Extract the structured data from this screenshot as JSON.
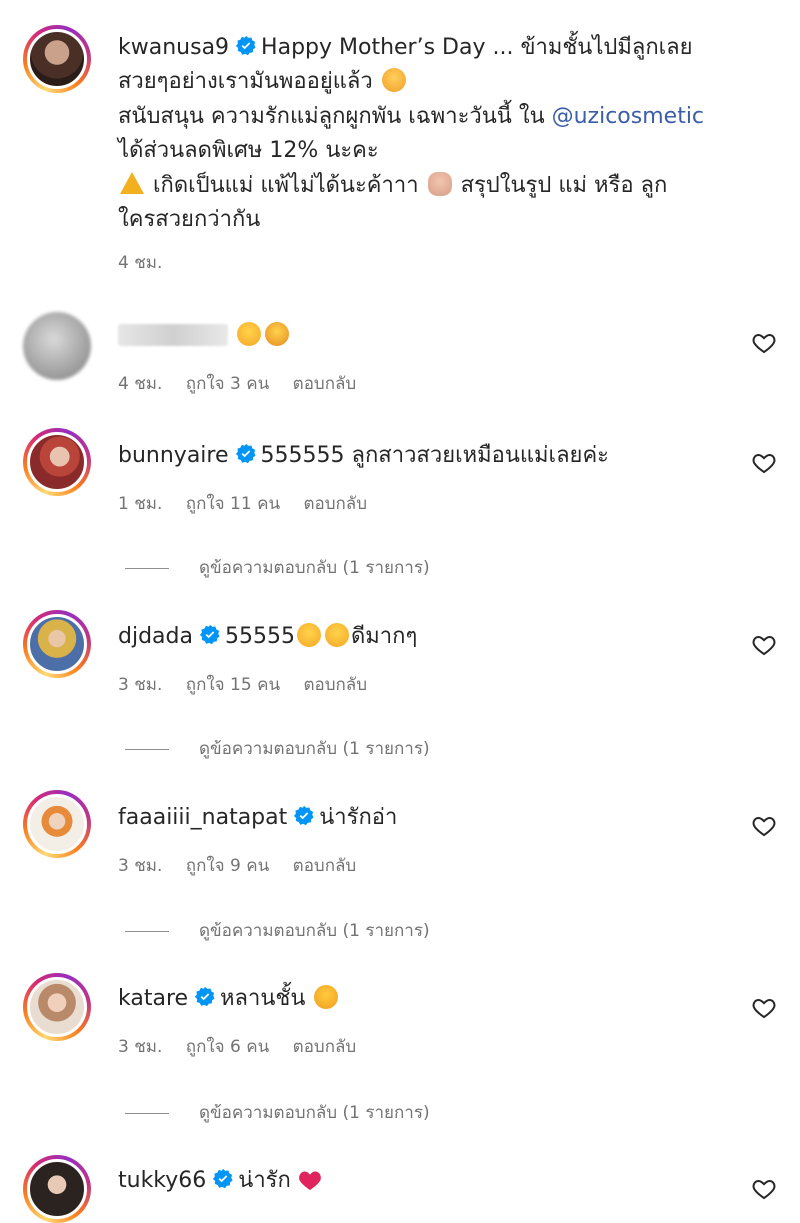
{
  "post": {
    "username": "kwanusa9",
    "lines": [
      "Happy Mother’s Day ... ข้ามชั้นไปมีลูกเลย",
      "สวยๆอย่างเรามันพออยู่แล้ว",
      "สนับสนุน ความรักแม่ลูกผูกพัน เฉพาะวันนี้ ใน",
      "ได้ส่วนลดพิเศษ 12% นะคะ",
      "เกิดเป็นแม่ แพ้ไม่ได้นะค้าาา",
      "สรุปในรูป แม่ หรือ ลูก",
      "ใครสวยกว่ากัน"
    ],
    "mention": "@uzicosmetic",
    "time": "4 ชม."
  },
  "labels": {
    "reply": "ตอบกลับ",
    "view_replies": "ดูข้อความตอบกลับ (1 รายการ)"
  },
  "comments": [
    {
      "username": "",
      "text": "",
      "time": "4 ชม.",
      "likes": "ถูกใจ 3 คน",
      "has_replies": false,
      "icons": [
        "rofl-emoji",
        "hugging-emoji"
      ]
    },
    {
      "username": "bunnyaire",
      "text": "555555 ลูกสาวสวยเหมือนแม่เลยค่ะ",
      "time": "1 ชม.",
      "likes": "ถูกใจ 11 คน",
      "has_replies": true
    },
    {
      "username": "djdada",
      "text": "55555",
      "text2": "ดีมากๆ",
      "time": "3 ชม.",
      "likes": "ถูกใจ 15 คน",
      "has_replies": true
    },
    {
      "username": "faaaiiii_natapat",
      "text": "น่ารักอ่า",
      "time": "3 ชม.",
      "likes": "ถูกใจ 9 คน",
      "has_replies": true
    },
    {
      "username": "katare",
      "text": "หลานชั้น",
      "time": "3 ชม.",
      "likes": "ถูกใจ 6 คน",
      "has_replies": true
    },
    {
      "username": "tukky66",
      "text": "น่ารัก",
      "time": "",
      "likes": "",
      "has_replies": false
    }
  ],
  "colors": {
    "verified": "#0095f6",
    "mention": "#3b5ea8",
    "muted": "#737373"
  }
}
